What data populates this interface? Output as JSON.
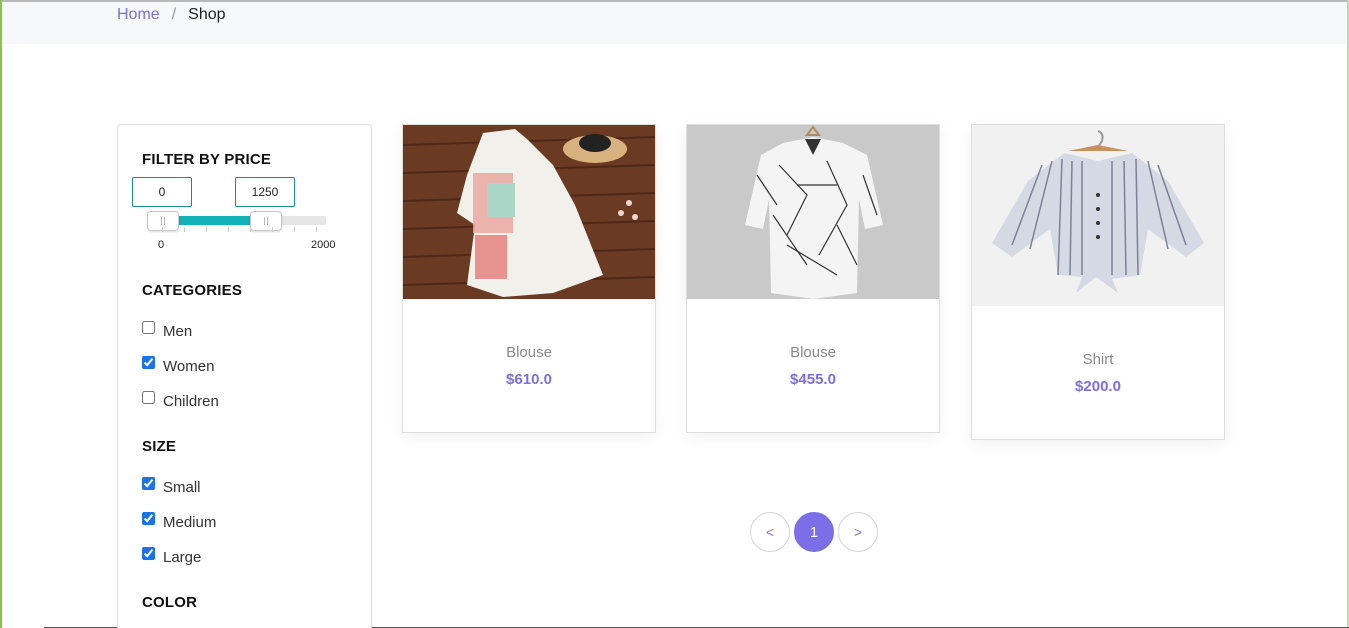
{
  "breadcrumb": {
    "home": "Home",
    "separator": "/",
    "current": "Shop"
  },
  "filters": {
    "price": {
      "title": "FILTER BY PRICE",
      "min_value": "0",
      "max_value": "1250",
      "scale_min": "0",
      "scale_max": "2000",
      "accent_color": "#12b3b8"
    },
    "categories": {
      "title": "CATEGORIES",
      "items": [
        {
          "label": "Men",
          "checked": false
        },
        {
          "label": "Women",
          "checked": true
        },
        {
          "label": "Children",
          "checked": false
        }
      ]
    },
    "size": {
      "title": "SIZE",
      "items": [
        {
          "label": "Small",
          "checked": true
        },
        {
          "label": "Medium",
          "checked": true
        },
        {
          "label": "Large",
          "checked": true
        }
      ]
    },
    "color": {
      "title": "COLOR"
    }
  },
  "products": [
    {
      "name": "Blouse",
      "price": "$610.0",
      "image": "white-blouse-on-wooden-floor"
    },
    {
      "name": "Blouse",
      "price": "$455.0",
      "image": "white-patterned-shirt-on-hanger"
    },
    {
      "name": "Shirt",
      "price": "$200.0",
      "image": "striped-tie-front-top-on-hanger"
    }
  ],
  "pagination": {
    "prev": "<",
    "current": "1",
    "next": ">"
  },
  "colors": {
    "accent": "#7b6ee6",
    "teal": "#12b3b8"
  }
}
